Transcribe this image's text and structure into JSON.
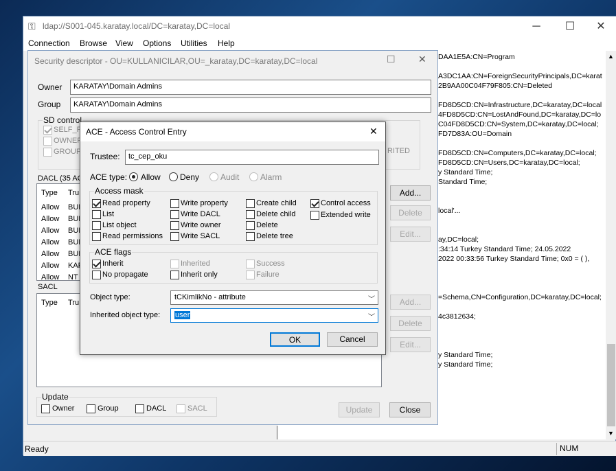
{
  "ldp": {
    "title": "ldap://S001-045.karatay.local/DC=karatay,DC=local",
    "icon": "ldp-app-icon",
    "menu": [
      "Connection",
      "Browse",
      "View",
      "Options",
      "Utilities",
      "Help"
    ],
    "status": "Ready",
    "num": "NUM",
    "right_lines": [
      "DAA1E5A:CN=Program",
      "A3DC1AA:CN=ForeignSecurityPrincipals,DC=karat",
      "2B9AA00C04F79F805:CN=Deleted",
      "FD8D5CD:CN=Infrastructure,DC=karatay,DC=local",
      "4FD8D5CD:CN=LostAndFound,DC=karatay,DC=lo",
      "C04FD8D5CD:CN=System,DC=karatay,DC=local;",
      "FD7D83A:OU=Domain",
      "FD8D5CD:CN=Computers,DC=karatay,DC=local;",
      "FD8D5CD:CN=Users,DC=karatay,DC=local;",
      "y Standard Time;",
      "Standard Time;",
      "local'...",
      "ay,DC=local;",
      ":34:14 Turkey Standard Time; 24.05.2022",
      "2022 00:33:56 Turkey Standard Time; 0x0 = ( ),",
      "=Schema,CN=Configuration,DC=karatay,DC=local;",
      "4c3812634;",
      "y Standard Time;",
      "y Standard Time;"
    ]
  },
  "sd": {
    "title": "Security descriptor - OU=KULLANICILAR,OU=_karatay,DC=karatay,DC=local",
    "owner_label": "Owner",
    "owner_value": "KARATAY\\Domain Admins",
    "group_label": "Group",
    "group_value": "KARATAY\\Domain Admins",
    "sd_control_title": "SD control",
    "sd_control_items": [
      "SELF_RE",
      "OWNER_",
      "GROUP_"
    ],
    "inherited_fragment": "RITED",
    "dacl_title": "DACL (35 AC",
    "dacl_columns": [
      "Type",
      "Tru"
    ],
    "dacl_rows": [
      {
        "type": "Allow",
        "trustee": "BUI"
      },
      {
        "type": "Allow",
        "trustee": "BUI"
      },
      {
        "type": "Allow",
        "trustee": "BUI"
      },
      {
        "type": "Allow",
        "trustee": "BUI"
      },
      {
        "type": "Allow",
        "trustee": "BUI"
      },
      {
        "type": "Allow",
        "trustee": "KAR"
      },
      {
        "type": "Allow",
        "trustee": "NT"
      }
    ],
    "sacl_title": "SACL",
    "sacl_columns": [
      "Type",
      "Tru"
    ],
    "buttons": {
      "add": "Add...",
      "delete": "Delete",
      "edit": "Edit..."
    },
    "update_title": "Update",
    "update_items": [
      "Owner",
      "Group",
      "DACL",
      "SACL"
    ],
    "update_button": "Update",
    "close_button": "Close"
  },
  "ace": {
    "title": "ACE - Access Control Entry",
    "trustee_label": "Trustee:",
    "trustee_value": "tc_cep_oku",
    "ace_type_label": "ACE type:",
    "ace_types": [
      {
        "label": "Allow",
        "selected": true,
        "enabled": true
      },
      {
        "label": "Deny",
        "selected": false,
        "enabled": true
      },
      {
        "label": "Audit",
        "selected": false,
        "enabled": false
      },
      {
        "label": "Alarm",
        "selected": false,
        "enabled": false
      }
    ],
    "access_mask_title": "Access mask",
    "access_mask": [
      {
        "label": "Read property",
        "checked": true
      },
      {
        "label": "Write property",
        "checked": false
      },
      {
        "label": "Create child",
        "checked": false
      },
      {
        "label": "Control access",
        "checked": true
      },
      {
        "label": "List",
        "checked": false
      },
      {
        "label": "Write DACL",
        "checked": false
      },
      {
        "label": "Delete child",
        "checked": false
      },
      {
        "label": "Extended write",
        "checked": false
      },
      {
        "label": "List object",
        "checked": false
      },
      {
        "label": "Write owner",
        "checked": false
      },
      {
        "label": "Delete",
        "checked": false
      },
      {
        "label": "Read permissions",
        "checked": false
      },
      {
        "label": "Write SACL",
        "checked": false
      },
      {
        "label": "Delete tree",
        "checked": false
      }
    ],
    "ace_flags_title": "ACE flags",
    "ace_flags": [
      {
        "label": "Inherit",
        "checked": true,
        "enabled": true
      },
      {
        "label": "Inherited",
        "checked": false,
        "enabled": false
      },
      {
        "label": "Success",
        "checked": false,
        "enabled": false
      },
      {
        "label": "No propagate",
        "checked": false,
        "enabled": true
      },
      {
        "label": "Inherit only",
        "checked": false,
        "enabled": true
      },
      {
        "label": "Failure",
        "checked": false,
        "enabled": false
      }
    ],
    "object_type_label": "Object type:",
    "object_type_value": "tCKimlikNo - attribute",
    "inherited_type_label": "Inherited object type:",
    "inherited_type_value": "user",
    "ok": "OK",
    "cancel": "Cancel"
  }
}
